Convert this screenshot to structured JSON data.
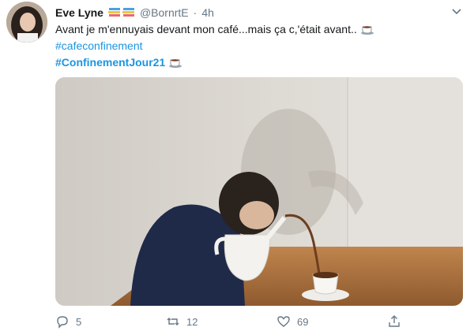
{
  "tweet": {
    "author_name": "Eve Lyne",
    "handle": "@BornrtE",
    "separator": "·",
    "time": "4h",
    "text": "Avant je m'ennuyais devant  mon café...mais ça c,'était avant..",
    "hashtags": [
      "#cafeconfinement",
      "#ConfinementJour21"
    ]
  },
  "actions": {
    "replies": "5",
    "retweets": "12",
    "likes": "69"
  },
  "icons": {
    "avatar": "avatar-photo",
    "badges": [
      "book-stack-emoji",
      "book-stack-emoji"
    ],
    "coffee": "hot-beverage-emoji",
    "more": "chevron-down-icon",
    "reply": "reply-icon",
    "retweet": "retweet-icon",
    "like": "heart-icon",
    "share": "share-icon"
  },
  "colors": {
    "link": "#1b95e0",
    "muted": "#657786",
    "text": "#14171a"
  }
}
